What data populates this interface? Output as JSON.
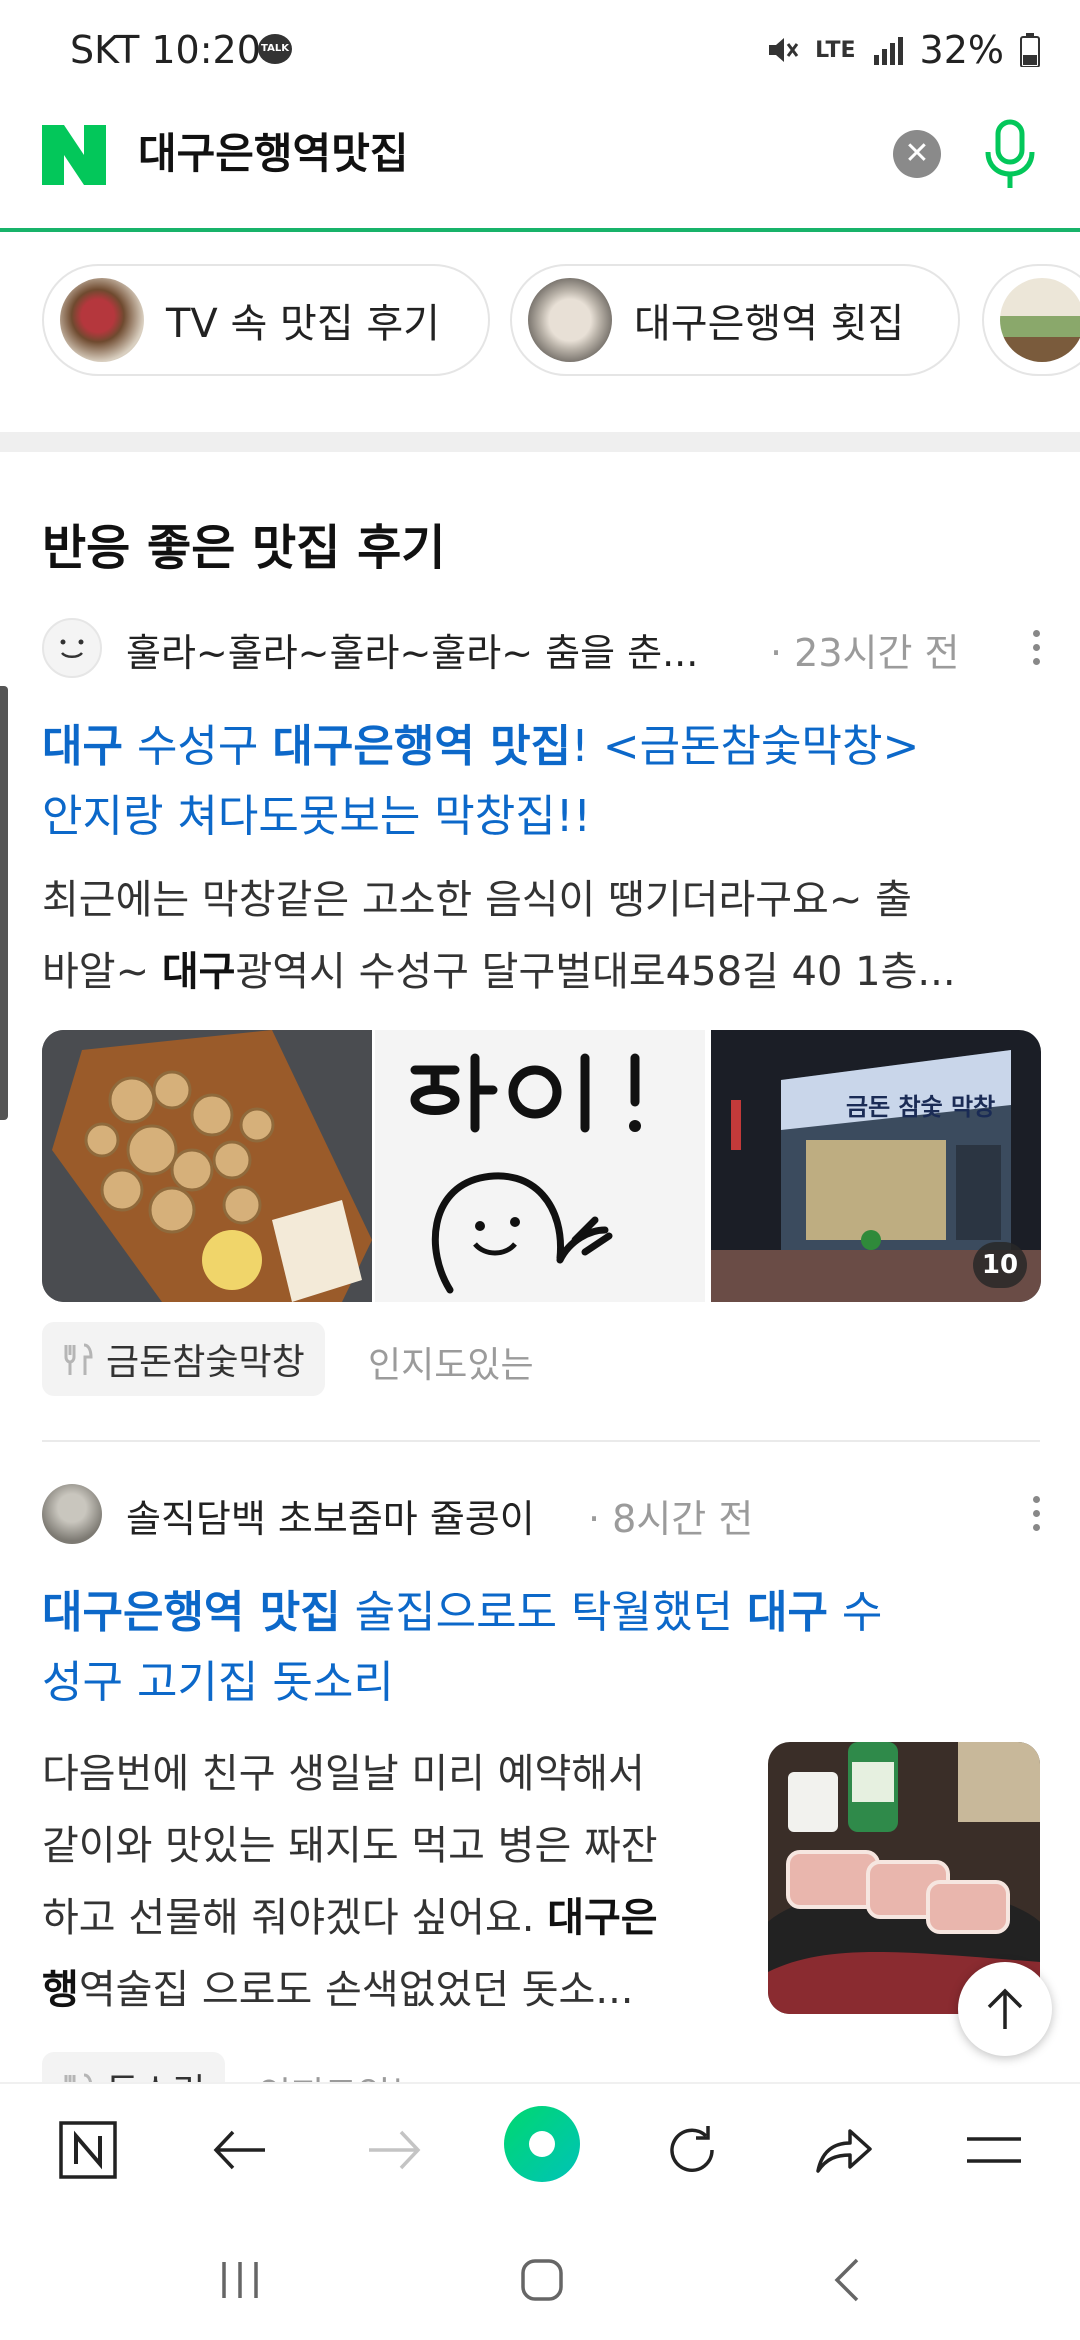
{
  "status": {
    "carrier_time": "SKT 10:20",
    "talk_badge": "TALK",
    "network": "LTE",
    "battery": "32%"
  },
  "search": {
    "query": "대구은행역맛집"
  },
  "chips": [
    {
      "label": "TV 속 맛집 후기"
    },
    {
      "label": "대구은행역 횟집"
    }
  ],
  "section": {
    "title": "반응 좋은 맛집 후기"
  },
  "posts": [
    {
      "author": "훌라~훌라~훌라~훌라~ 춤을 춘...",
      "time": "23시간 전",
      "title_parts": [
        "대구",
        " 수성구 ",
        "대구은행역 맛집",
        "! <금돈참숯막창>"
      ],
      "title_line2": "안지랑 쳐다도못보는 막창집!!",
      "desc_line1": "최근에는 막창같은 고소한 음식이 땡기더라구요~ 출",
      "desc_line2_a": "바알~ ",
      "desc_line2_b": "대구",
      "desc_line2_c": "광역시 수성구 달구벌대로458길 40 1층...",
      "image_count": "10",
      "tag": "금돈참숯막창",
      "tag_sub": "인지도있는"
    },
    {
      "author": "솔직담백 초보줌마 쥴콩이",
      "time": "8시간 전",
      "title_parts": [
        "대구은행역 맛집",
        " 술집으로도 탁월했던 ",
        "대구",
        " 수"
      ],
      "title_line2": "성구 고기집 돗소리",
      "desc_line1": "다음번에 친구 생일날 미리 예약해서",
      "desc_line2": "같이와 맛있는 돼지도 먹고 병은 짜잔",
      "desc_line3_a": "하고 선물해 줘야겠다 싶어요. ",
      "desc_line3_b": "대구은",
      "desc_line4_a": "행",
      "desc_line4_b": "역술집 으로도 손색없었던 돗소...",
      "tag": "돗소리",
      "tag_sub": "인지도있는"
    }
  ],
  "colors": {
    "brand_green": "#03c75a",
    "link_blue": "#0c68c9"
  }
}
